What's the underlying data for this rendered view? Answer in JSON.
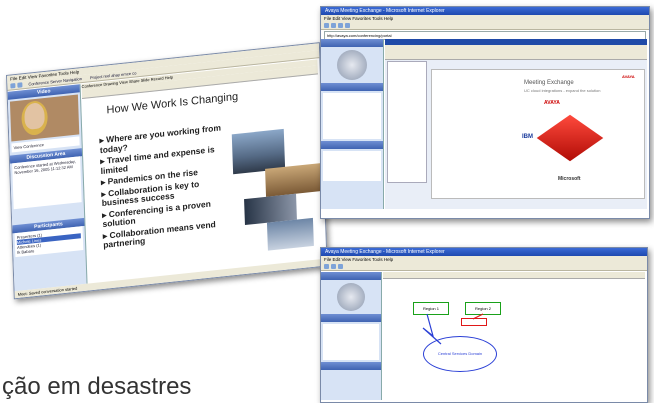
{
  "caption": "ção em desastres",
  "shot1": {
    "menu": "File  Edit  View  Favorites  Tools  Help",
    "tab1": "Conference Server Navigation",
    "tab2": "Project reel ahay ernce co",
    "video_label": "Video",
    "video_caption": "View Conference",
    "discussion_label": "Discussion Area",
    "discussion_text": "Conference started at Wednesday, November 16, 2005 11:12:32 AM",
    "participants_label": "Participants",
    "participants": [
      "Presenters (1)",
      "Michele Lines",
      "Attendees (1)",
      "Ik Babaru"
    ],
    "slide_menu": "Conference  Drawing  View  Share  Slide  Record  Help",
    "slide_title": "How We Work Is Changing",
    "bullets": [
      "Where are you working from today?",
      "Travel time and expense is limited",
      "Pandemics on the rise",
      "Collaboration is key to business success",
      "Conferencing is a proven solution",
      "Collaboration means vend partnering"
    ],
    "status": "Meet: Saved conversation started"
  },
  "shot2": {
    "title": "Avaya Meeting Exchange - Microsoft Internet Explorer",
    "menu": "File  Edit  View  Favorites  Tools  Help",
    "address": "http://avaya.com/conferencing/portal",
    "slide_title": "Meeting Exchange",
    "slide_sub": "UC cloud integrations - expand the solution",
    "brand": "AVAYA",
    "brand2": "IBM",
    "brand3": "Microsoft"
  },
  "shot3": {
    "title": "Avaya Meeting Exchange - Microsoft Internet Explorer",
    "box1": "Region 1",
    "box2": "Region 2",
    "ellipse": "Central Services Domain"
  }
}
